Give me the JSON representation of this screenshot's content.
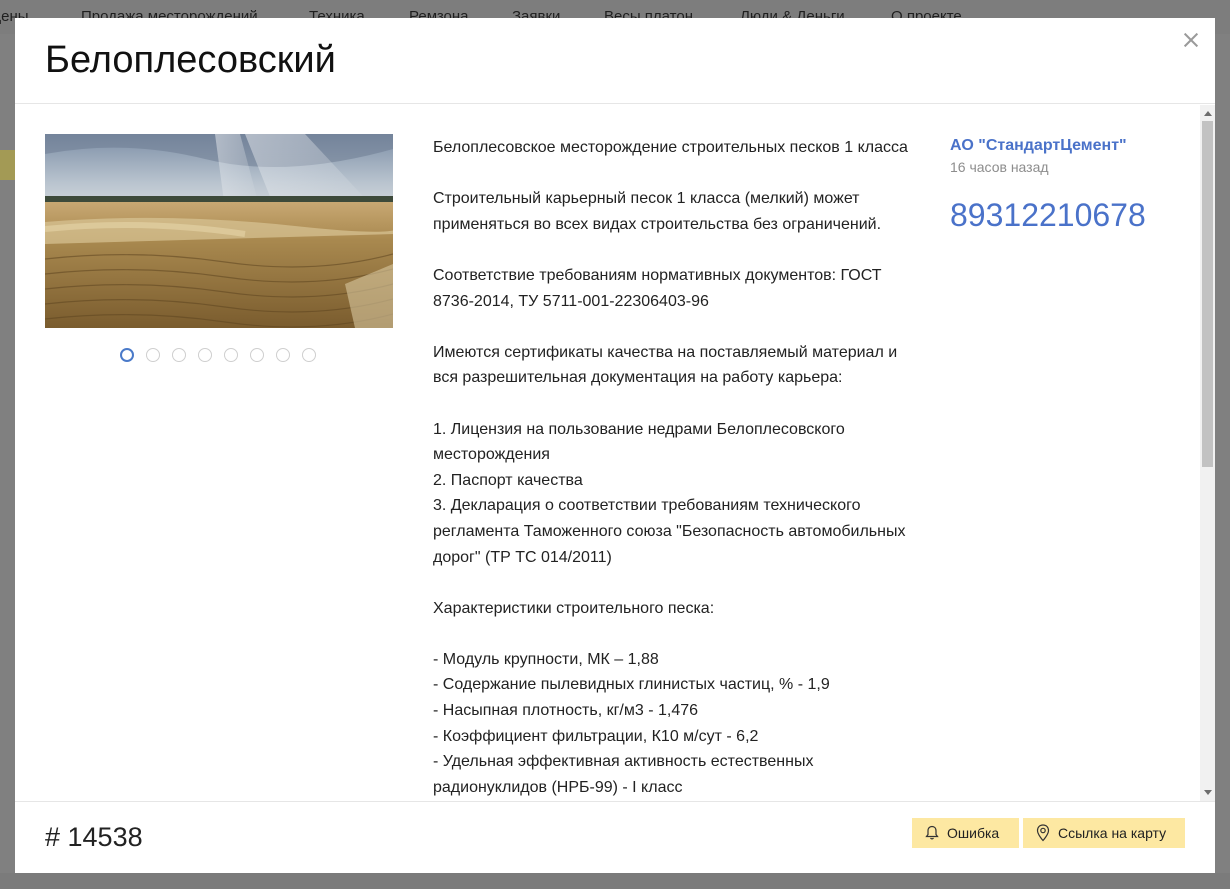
{
  "background_nav": {
    "items": [
      "Цены",
      "Продажа месторождений",
      "Техника",
      "Ремзона",
      "Заявки",
      "Весы платон",
      "Люди & Деньги",
      "О проекте"
    ]
  },
  "modal": {
    "title": "Белоплесовский",
    "close_icon": "close-icon",
    "gallery": {
      "dot_count": 8,
      "active_index": 0
    },
    "description": [
      "Белоплесовское месторождение строительных песков 1 класса",
      "",
      "Строительный карьерный песок 1 класса (мелкий) может применяться во всех видах строительства без ограничений.",
      "",
      "Соответствие требованиям нормативных документов: ГОСТ 8736-2014, ТУ 5711-001-22306403-96",
      "",
      "Имеются сертификаты качества на поставляемый материал и вся разрешительная документация на работу карьера:",
      "",
      "1. Лицензия на пользование недрами Белоплесовского месторождения",
      "2. Паспорт качества",
      "3. Декларация о соответствии требованиям технического регламента Таможенного союза \"Безопасность автомобильных дорог\" (ТР ТС 014/2011)",
      "",
      "Характеристики строительного песка:",
      "",
      "- Модуль крупности, МК – 1,88",
      "- Содержание пылевидных глинистых частиц, % - 1,9",
      "- Насыпная плотность, кг/м3 - 1,476",
      "- Коэффициент фильтрации, К10 м/сут - 6,2",
      "- Удельная эффективная активность естественных радионуклидов (НРБ-99) - I класс"
    ],
    "seller": {
      "name": "АО \"СтандартЦемент\"",
      "time": "16 часов назад",
      "phone": "89312210678"
    },
    "footer": {
      "ad_number": "# 14538",
      "error_button": "Ошибка",
      "map_button": "Ссылка на карту"
    }
  },
  "colors": {
    "accent": "#4a72c9",
    "button_bg": "#fde8a2",
    "overlay": "#7a7a7a"
  }
}
